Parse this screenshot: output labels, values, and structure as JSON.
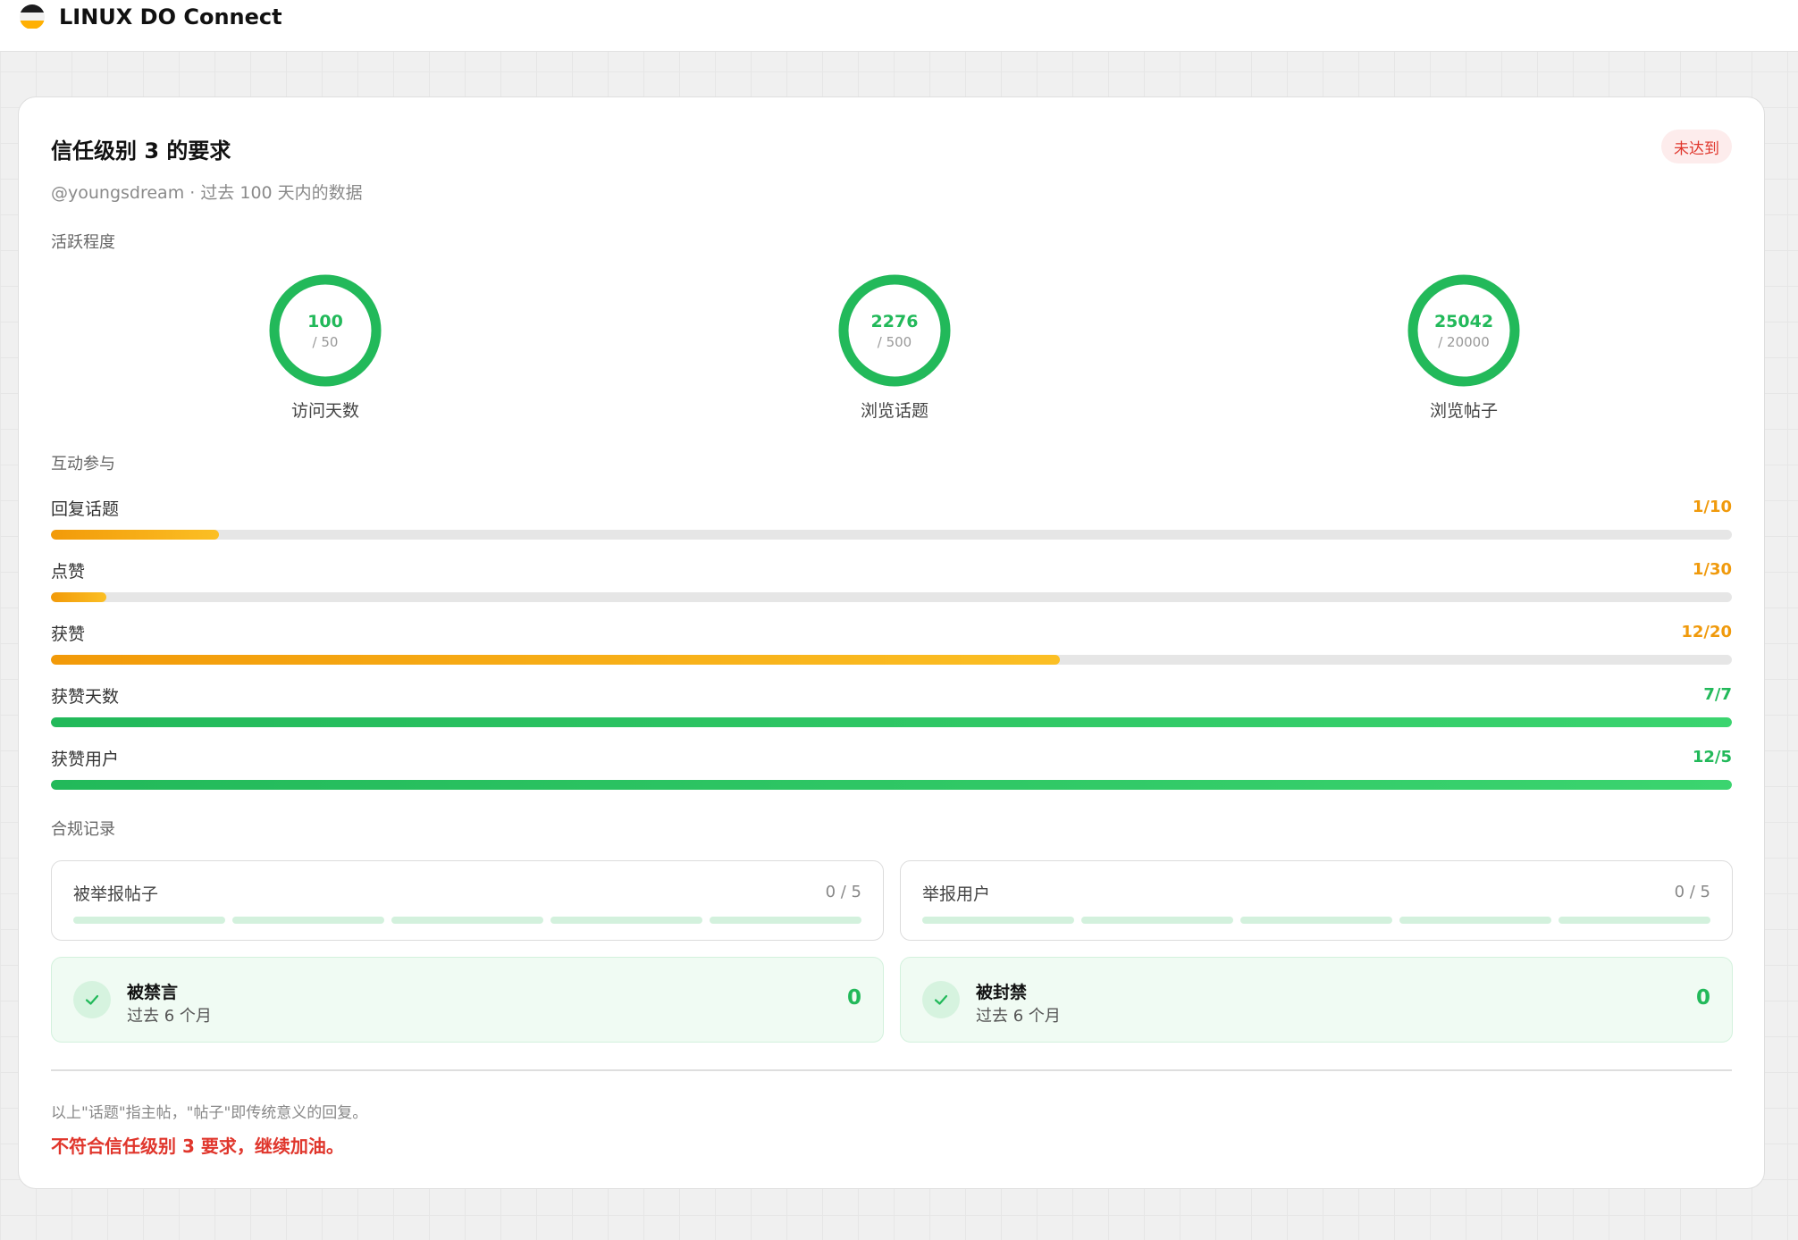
{
  "header": {
    "brand": "LINUX DO Connect"
  },
  "card": {
    "title": "信任级别 3 的要求",
    "status_badge": "未达到",
    "subtitle": "@youngsdream · 过去 100 天内的数据"
  },
  "activity": {
    "label": "活跃程度",
    "rings": [
      {
        "value": "100",
        "target": "/ 50",
        "label": "访问天数",
        "progress": 1.0
      },
      {
        "value": "2276",
        "target": "/ 500",
        "label": "浏览话题",
        "progress": 1.0
      },
      {
        "value": "25042",
        "target": "/ 20000",
        "label": "浏览帖子",
        "progress": 1.0
      }
    ]
  },
  "interaction": {
    "label": "互动参与",
    "bars": [
      {
        "label": "回复话题",
        "value": "1/10",
        "progress": 0.1,
        "status": "orange"
      },
      {
        "label": "点赞",
        "value": "1/30",
        "progress": 0.033,
        "status": "orange"
      },
      {
        "label": "获赞",
        "value": "12/20",
        "progress": 0.6,
        "status": "orange"
      },
      {
        "label": "获赞天数",
        "value": "7/7",
        "progress": 1.0,
        "status": "green"
      },
      {
        "label": "获赞用户",
        "value": "12/5",
        "progress": 1.0,
        "status": "green"
      }
    ]
  },
  "compliance": {
    "label": "合规记录",
    "reports": [
      {
        "label": "被举报帖子",
        "value": "0 / 5"
      },
      {
        "label": "举报用户",
        "value": "0 / 5"
      }
    ],
    "penalties": [
      {
        "title": "被禁言",
        "sub": "过去 6 个月",
        "value": "0"
      },
      {
        "title": "被封禁",
        "sub": "过去 6 个月",
        "value": "0"
      }
    ]
  },
  "footer": {
    "note": "以上\"话题\"指主帖，\"帖子\"即传统意义的回复。",
    "verdict": "不符合信任级别 3 要求，继续加油。"
  },
  "colors": {
    "accent_green": "#22b95a",
    "accent_orange": "#f09a0c",
    "danger_red": "#e0362c"
  },
  "icons": {
    "check": "check-icon",
    "logo": "linux-do-logo-icon"
  }
}
